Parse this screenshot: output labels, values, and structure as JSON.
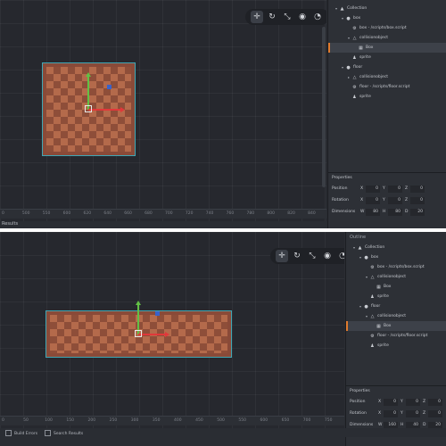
{
  "colors": {
    "viewport_bg": "#26282e",
    "sprite_dark": "#8e4e39",
    "sprite_light": "#b46a4b",
    "selection_border": "#3fa7b5",
    "axis_x": "#e0383a",
    "axis_y": "#62c045",
    "axis_z": "#3a62c9",
    "selection_marker": "#e07b2e"
  },
  "toolbar": {
    "buttons": [
      {
        "name": "move-tool",
        "icon": "move-icon",
        "glyph": "✛"
      },
      {
        "name": "rotate-tool",
        "icon": "rotate-icon",
        "glyph": "↻"
      },
      {
        "name": "scale-tool",
        "icon": "scale-icon",
        "glyph": "⤡"
      },
      {
        "name": "visibility-tool",
        "icon": "eye-icon",
        "glyph": "◉"
      },
      {
        "name": "camera-tool",
        "icon": "camera-icon",
        "glyph": "◔"
      }
    ]
  },
  "screen1": {
    "ruler_ticks": [
      "0",
      "500",
      "550",
      "600",
      "620",
      "640",
      "660",
      "680",
      "700",
      "720",
      "740",
      "760",
      "780",
      "800",
      "820",
      "840"
    ],
    "outline": [
      {
        "label": "Collection",
        "icon": "collection-icon",
        "glyph": "▲",
        "depth": 0,
        "expanded": true
      },
      {
        "label": "box",
        "icon": "gameobject-icon",
        "glyph": "●",
        "depth": 1,
        "expanded": true
      },
      {
        "label": "box - /scripts/box.script",
        "icon": "script-icon",
        "glyph": "⚙",
        "depth": 2
      },
      {
        "label": "collisionobject",
        "icon": "collision-icon",
        "glyph": "△",
        "depth": 2,
        "expanded": true
      },
      {
        "label": "Box",
        "icon": "shape-icon",
        "glyph": "▦",
        "depth": 3,
        "selected": true
      },
      {
        "label": "sprite",
        "icon": "sprite-icon",
        "glyph": "♟",
        "depth": 2
      },
      {
        "label": "floor",
        "icon": "gameobject-icon",
        "glyph": "●",
        "depth": 1,
        "expanded": true
      },
      {
        "label": "collisionobject",
        "icon": "collision-icon",
        "glyph": "△",
        "depth": 2,
        "collapsed": true
      },
      {
        "label": "floor - /scripts/floor.script",
        "icon": "script-icon",
        "glyph": "⚙",
        "depth": 2
      },
      {
        "label": "sprite",
        "icon": "sprite-icon",
        "glyph": "♟",
        "depth": 2
      }
    ],
    "properties": {
      "title": "Properties",
      "rows": [
        {
          "label": "Position",
          "axes": [
            "X",
            "Y",
            "Z"
          ],
          "values": [
            "0",
            "0",
            "0"
          ]
        },
        {
          "label": "Rotation",
          "axes": [
            "X",
            "Y",
            "Z"
          ],
          "values": [
            "0",
            "0",
            "0"
          ]
        },
        {
          "label": "Dimensions",
          "axes": [
            "W",
            "H",
            "D"
          ],
          "values": [
            "80",
            "80",
            "20"
          ]
        }
      ]
    },
    "results_label": "Results"
  },
  "screen2": {
    "ruler_ticks": [
      "0",
      "50",
      "100",
      "150",
      "200",
      "250",
      "300",
      "350",
      "400",
      "450",
      "500",
      "550",
      "600",
      "650",
      "700",
      "750"
    ],
    "outline_title": "Outline",
    "outline": [
      {
        "label": "Collection",
        "icon": "collection-icon",
        "glyph": "▲",
        "depth": 0,
        "expanded": true
      },
      {
        "label": "box",
        "icon": "gameobject-icon",
        "glyph": "●",
        "depth": 1,
        "expanded": true
      },
      {
        "label": "box - /scripts/box.script",
        "icon": "script-icon",
        "glyph": "⚙",
        "depth": 2
      },
      {
        "label": "collisionobject",
        "icon": "collision-icon",
        "glyph": "△",
        "depth": 2,
        "expanded": true
      },
      {
        "label": "Box",
        "icon": "shape-icon",
        "glyph": "▦",
        "depth": 3
      },
      {
        "label": "sprite",
        "icon": "sprite-icon",
        "glyph": "♟",
        "depth": 2
      },
      {
        "label": "floor",
        "icon": "gameobject-icon",
        "glyph": "●",
        "depth": 1,
        "expanded": true
      },
      {
        "label": "collisionobject",
        "icon": "collision-icon",
        "glyph": "△",
        "depth": 2,
        "expanded": true
      },
      {
        "label": "Box",
        "icon": "shape-icon",
        "glyph": "▦",
        "depth": 3,
        "selected": true
      },
      {
        "label": "floor - /scripts/floor.script",
        "icon": "script-icon",
        "glyph": "⚙",
        "depth": 2
      },
      {
        "label": "sprite",
        "icon": "sprite-icon",
        "glyph": "♟",
        "depth": 2
      }
    ],
    "properties": {
      "title": "Properties",
      "rows": [
        {
          "label": "Position",
          "axes": [
            "X",
            "Y",
            "Z"
          ],
          "values": [
            "0",
            "0",
            "0"
          ]
        },
        {
          "label": "Rotation",
          "axes": [
            "X",
            "Y",
            "Z"
          ],
          "values": [
            "0",
            "0",
            "0"
          ]
        },
        {
          "label": "Dimensions",
          "axes": [
            "W",
            "H",
            "D"
          ],
          "values": [
            "160",
            "40",
            "20"
          ]
        }
      ]
    },
    "bottom_tabs": [
      "Build Errors",
      "Search Results"
    ]
  }
}
